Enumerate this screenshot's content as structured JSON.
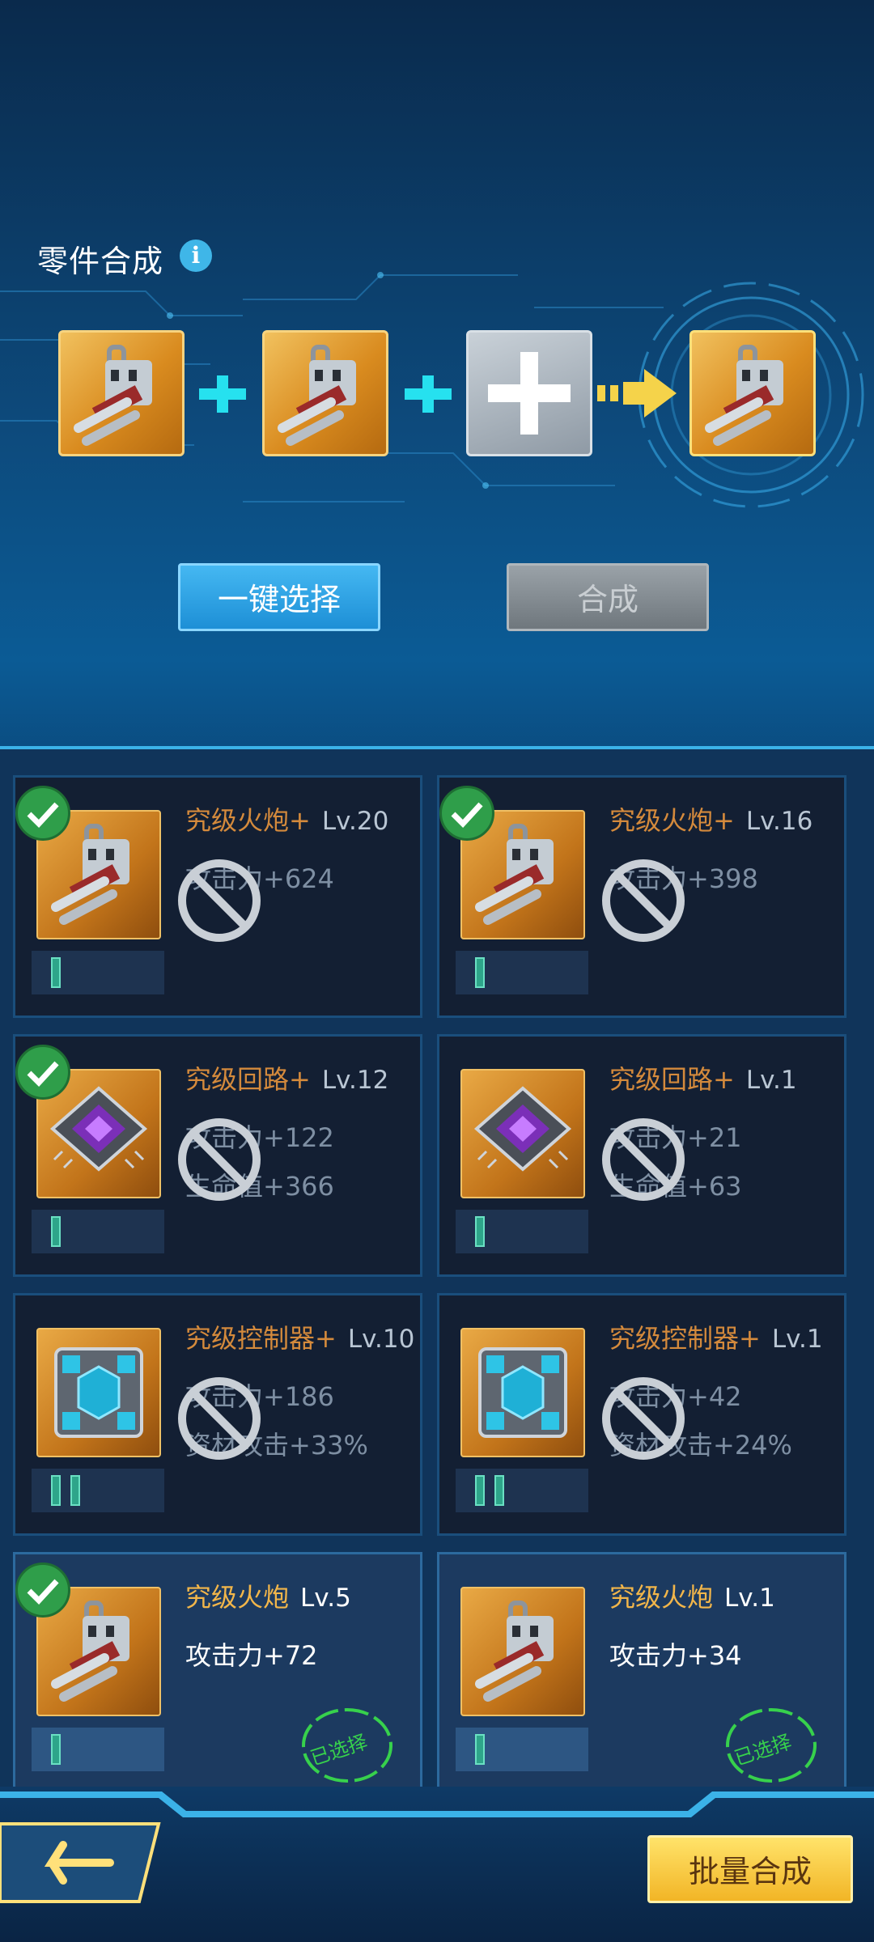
{
  "header": {
    "title": "零件合成",
    "info_icon": "i"
  },
  "buttons": {
    "auto_select": "一键选择",
    "synthesize": "合成",
    "batch": "批量合成"
  },
  "slots": [
    "cannon",
    "cannon",
    "empty",
    "cannon-result"
  ],
  "cards": [
    {
      "name": "究级火炮+",
      "level": "Lv.20",
      "stats": [
        "攻击力+624"
      ],
      "checked": true,
      "selected_stamp": "",
      "pips": 1,
      "icon": "cannon"
    },
    {
      "name": "究级火炮+",
      "level": "Lv.16",
      "stats": [
        "攻击力+398"
      ],
      "checked": true,
      "selected_stamp": "",
      "pips": 1,
      "icon": "cannon"
    },
    {
      "name": "究级回路+",
      "level": "Lv.12",
      "stats": [
        "攻击力+122",
        "生命值+366"
      ],
      "checked": true,
      "selected_stamp": "",
      "pips": 1,
      "icon": "circuit-chip"
    },
    {
      "name": "究级回路+",
      "level": "Lv.1",
      "stats": [
        "攻击力+21",
        "生命值+63"
      ],
      "checked": false,
      "selected_stamp": "",
      "pips": 1,
      "icon": "circuit-chip"
    },
    {
      "name": "究级控制器+",
      "level": "Lv.10",
      "stats": [
        "攻击力+186",
        "资材攻击+33%"
      ],
      "checked": false,
      "selected_stamp": "",
      "pips": 2,
      "icon": "controller"
    },
    {
      "name": "究级控制器+",
      "level": "Lv.1",
      "stats": [
        "攻击力+42",
        "资材攻击+24%"
      ],
      "checked": false,
      "selected_stamp": "",
      "pips": 2,
      "icon": "controller"
    },
    {
      "name": "究级火炮",
      "level": "Lv.5",
      "stats": [
        "攻击力+72"
      ],
      "checked": true,
      "selected_stamp": "已选择",
      "pips": 1,
      "icon": "cannon"
    },
    {
      "name": "究级火炮",
      "level": "Lv.1",
      "stats": [
        "攻击力+34"
      ],
      "checked": false,
      "selected_stamp": "已选择",
      "pips": 1,
      "icon": "cannon"
    }
  ],
  "colors": {
    "accent": "#3bb2e8",
    "gold": "#f2b64a",
    "select_green": "#37d14c"
  }
}
